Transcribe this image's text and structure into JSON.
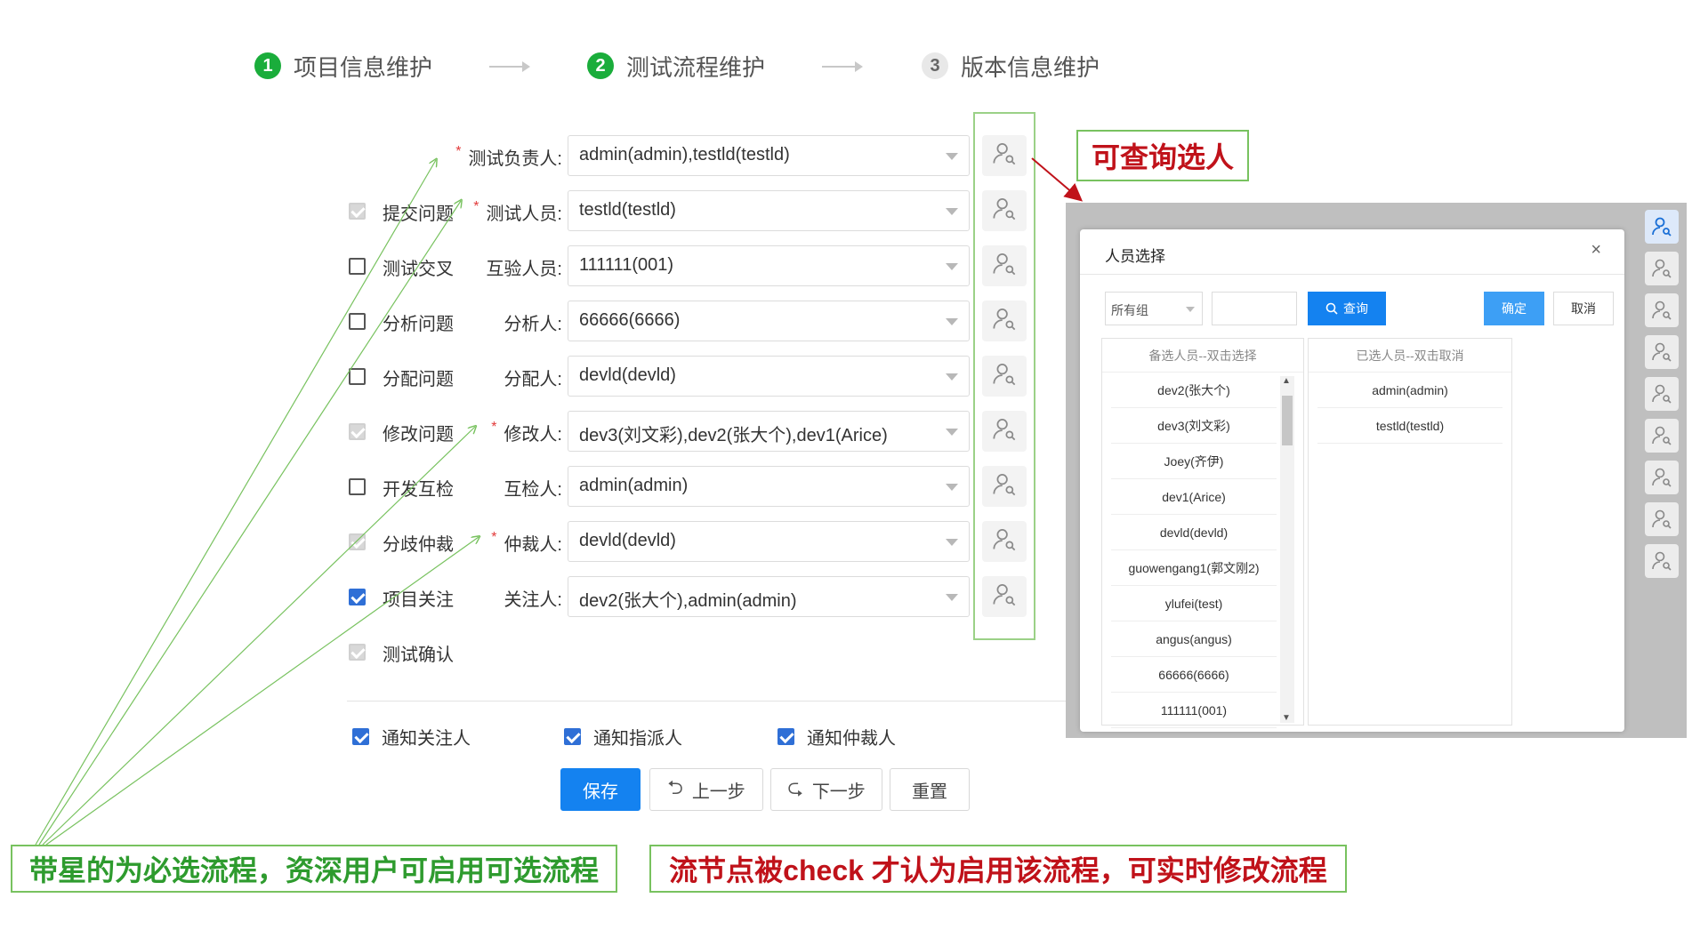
{
  "steps": [
    {
      "num": "1",
      "label": "项目信息维护",
      "state": "done"
    },
    {
      "num": "2",
      "label": "测试流程维护",
      "state": "done"
    },
    {
      "num": "3",
      "label": "版本信息维护",
      "state": "todo"
    }
  ],
  "rows": [
    {
      "checkbox": null,
      "cb_label": "",
      "required": true,
      "role": "测试负责人:",
      "value": "admin(admin),testld(testld)"
    },
    {
      "checkbox": "disabled",
      "cb_label": "提交问题",
      "required": true,
      "role": "测试人员:",
      "value": "testld(testld)"
    },
    {
      "checkbox": "unchecked",
      "cb_label": "测试交叉",
      "required": false,
      "role": "互验人员:",
      "value": "111111(001)"
    },
    {
      "checkbox": "unchecked",
      "cb_label": "分析问题",
      "required": false,
      "role": "分析人:",
      "value": "66666(6666)"
    },
    {
      "checkbox": "unchecked",
      "cb_label": "分配问题",
      "required": false,
      "role": "分配人:",
      "value": "devld(devld)"
    },
    {
      "checkbox": "disabled",
      "cb_label": "修改问题",
      "required": true,
      "role": "修改人:",
      "value": "dev3(刘文彩),dev2(张大个),dev1(Arice)"
    },
    {
      "checkbox": "unchecked",
      "cb_label": "开发互检",
      "required": false,
      "role": "互检人:",
      "value": "admin(admin)"
    },
    {
      "checkbox": "disabled",
      "cb_label": "分歧仲裁",
      "required": true,
      "role": "仲裁人:",
      "value": "devld(devld)"
    },
    {
      "checkbox": "checked",
      "cb_label": "项目关注",
      "required": false,
      "role": "关注人:",
      "value": "dev2(张大个),admin(admin)"
    },
    {
      "checkbox": "disabled",
      "cb_label": "测试确认",
      "required": false,
      "role": "",
      "value": ""
    }
  ],
  "notify": [
    {
      "label": "通知关注人",
      "checked": true
    },
    {
      "label": "通知指派人",
      "checked": true
    },
    {
      "label": "通知仲裁人",
      "checked": true
    }
  ],
  "buttons": {
    "save": "保存",
    "prev": "上一步",
    "next": "下一步",
    "reset": "重置"
  },
  "callouts": {
    "query": "可查询选人",
    "required_flow": "带星的为必选流程，资深用户可启用可选流程",
    "check_flow": "流节点被check 才认为启用该流程，可实时修改流程"
  },
  "dialog": {
    "title": "人员选择",
    "close": "×",
    "group": "所有组",
    "search": "查询",
    "ok": "确定",
    "cancel": "取消",
    "candidates_header": "备选人员--双击选择",
    "selected_header": "已选人员--双击取消",
    "candidates": [
      "dev2(张大个)",
      "dev3(刘文彩)",
      "Joey(齐伊)",
      "dev1(Arice)",
      "devld(devld)",
      "guowengang1(郭文刚2)",
      "ylufei(test)",
      "angus(angus)",
      "66666(6666)",
      "111111(001)"
    ],
    "selected": [
      "admin(admin)",
      "testld(testld)"
    ]
  },
  "colors": {
    "primary": "#1482f0",
    "step_done": "#1aad3b",
    "callout_border": "#78c25f",
    "callout_green_text": "#2e9b2e",
    "callout_red_text": "#c0121a",
    "required_star": "#e23a3a"
  },
  "icons": {
    "pick": "user-search-icon",
    "prev": "undo-icon",
    "next": "redo-icon",
    "search": "magnifier-icon"
  }
}
